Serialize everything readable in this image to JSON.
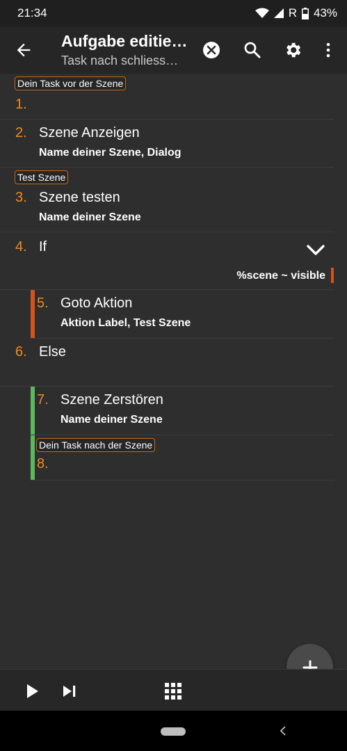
{
  "status_bar": {
    "time": "21:34",
    "carrier": "R",
    "battery": "43%",
    "icons": [
      "wifi-icon",
      "signal-icon",
      "battery-icon"
    ]
  },
  "app_bar": {
    "title": "Aufgabe editie…",
    "subtitle": "Task nach schliess…",
    "icons": [
      "back-arrow-icon",
      "clear-icon",
      "search-icon",
      "settings-gear-icon",
      "overflow-menu-icon"
    ]
  },
  "actions": [
    {
      "label": "Dein Task vor der Szene",
      "number": "1.",
      "name": "",
      "params": ""
    },
    {
      "label": "",
      "number": "2.",
      "name": "Szene Anzeigen",
      "params": "Name deiner Szene,  Dialog"
    },
    {
      "label": "Test Szene",
      "number": "3.",
      "name": "Szene testen",
      "params": "Name deiner Szene"
    },
    {
      "label": "",
      "number": "4.",
      "name": "If",
      "condition": "%scene ~ visible"
    },
    {
      "label": "",
      "number": "5.",
      "name": "Goto Aktion",
      "params": "Aktion Label, Test Szene"
    },
    {
      "label": "",
      "number": "6.",
      "name": "Else",
      "params": ""
    },
    {
      "label": "",
      "number": "7.",
      "name": "Szene Zerstören",
      "params": "Name deiner Szene"
    },
    {
      "label": "Dein Task nach der Szene",
      "number": "8.",
      "name": "",
      "params": ""
    }
  ],
  "colors": {
    "accent_orange": "#f28a1c",
    "if_branch_bar": "#d2531c",
    "else_branch_bar": "#5cb85c",
    "background": "#2e2e2e"
  },
  "bottom_bar": {
    "icons": [
      "play-icon",
      "step-forward-icon",
      "grid-icon"
    ]
  },
  "fab": {
    "icon": "add-icon"
  },
  "nav_bar": {
    "icons": [
      "home-pill",
      "back-chevron-icon"
    ]
  }
}
